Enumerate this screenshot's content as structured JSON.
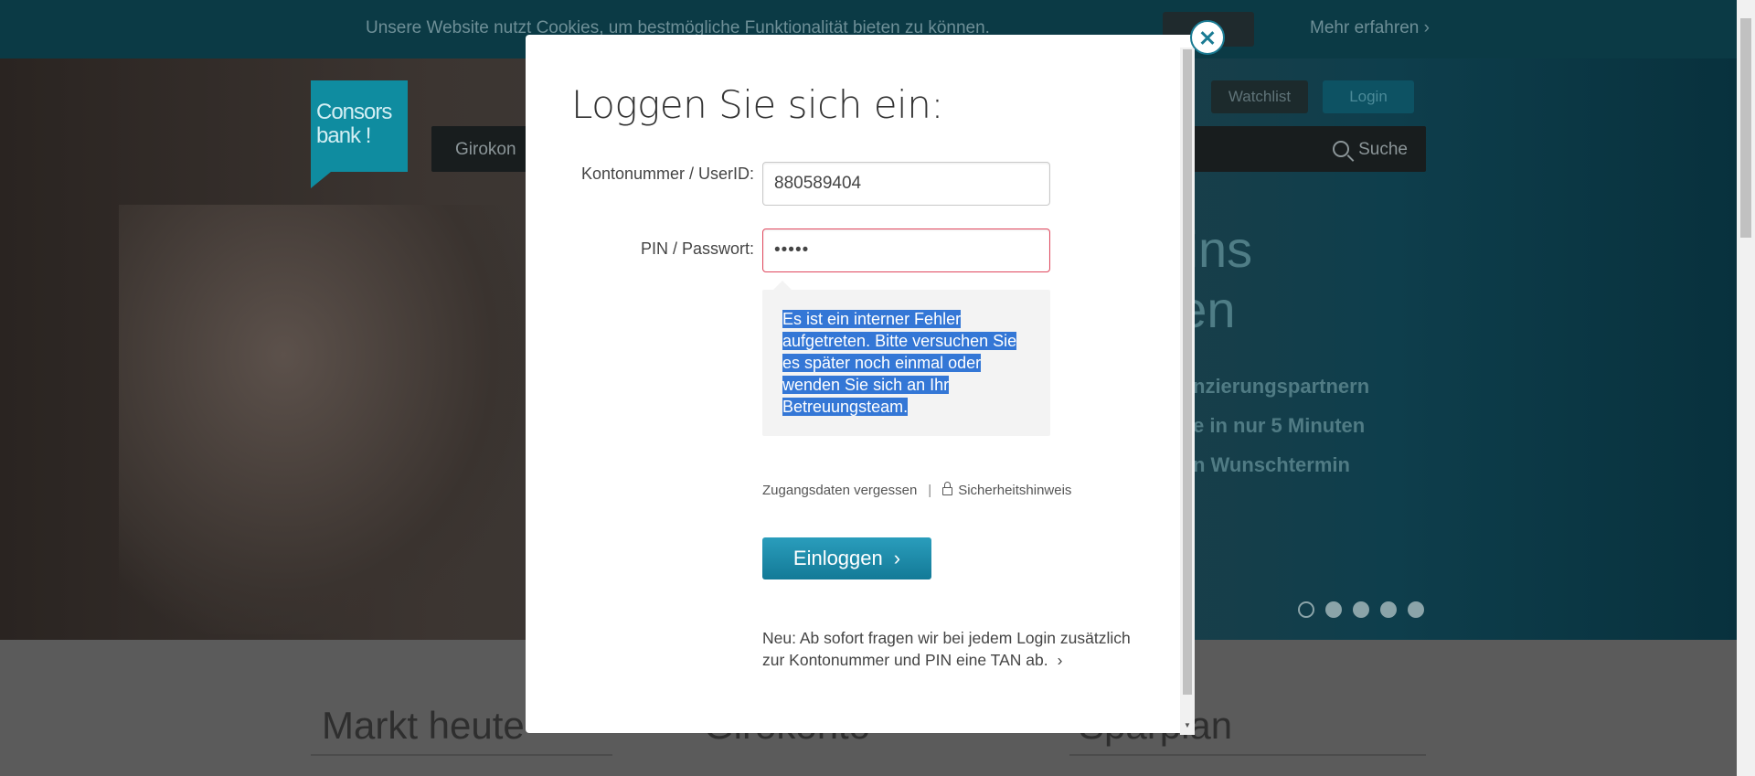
{
  "cookie_bar": {
    "text": "Unsere Website nutzt Cookies, um bestmögliche Funktionalität bieten zu können.",
    "more_label": "Mehr erfahren"
  },
  "header": {
    "logo_text": "Consors bank !",
    "nav_first_item": "Girokon",
    "search_label": "Suche",
    "watchlist_label": "Watchlist",
    "login_label": "Login"
  },
  "hero": {
    "title_lines": [
      "k ins",
      "rten"
    ],
    "list": [
      "nzierungspartnern",
      "e in nur 5 Minuten",
      "n Wunschtermin"
    ],
    "slide_count": 5,
    "active_slide": 0
  },
  "lower_sections": [
    "Markt heute",
    "Girokonto",
    "Sparplan"
  ],
  "modal": {
    "title": "Loggen Sie sich ein:",
    "user_label": "Kontonummer / UserID:",
    "user_value": "880589404",
    "pin_label": "PIN / Passwort:",
    "pin_value": "•••••",
    "error_message": "Es ist ein interner Fehler aufgetreten. Bitte versuchen Sie es später noch einmal oder wenden Sie sich an Ihr Betreuungsteam.",
    "forgot_link": "Zugangsdaten vergessen",
    "separator": "|",
    "security_link": "Sicherheitshinweis",
    "submit_label": "Einloggen",
    "notice": "Neu: Ab sofort fragen wir bei jedem Login zusätzlich zur Kontonummer und PIN eine TAN ab."
  },
  "colors": {
    "accent": "#137a97",
    "error_border": "#e0485e",
    "selection": "#3477d6"
  }
}
